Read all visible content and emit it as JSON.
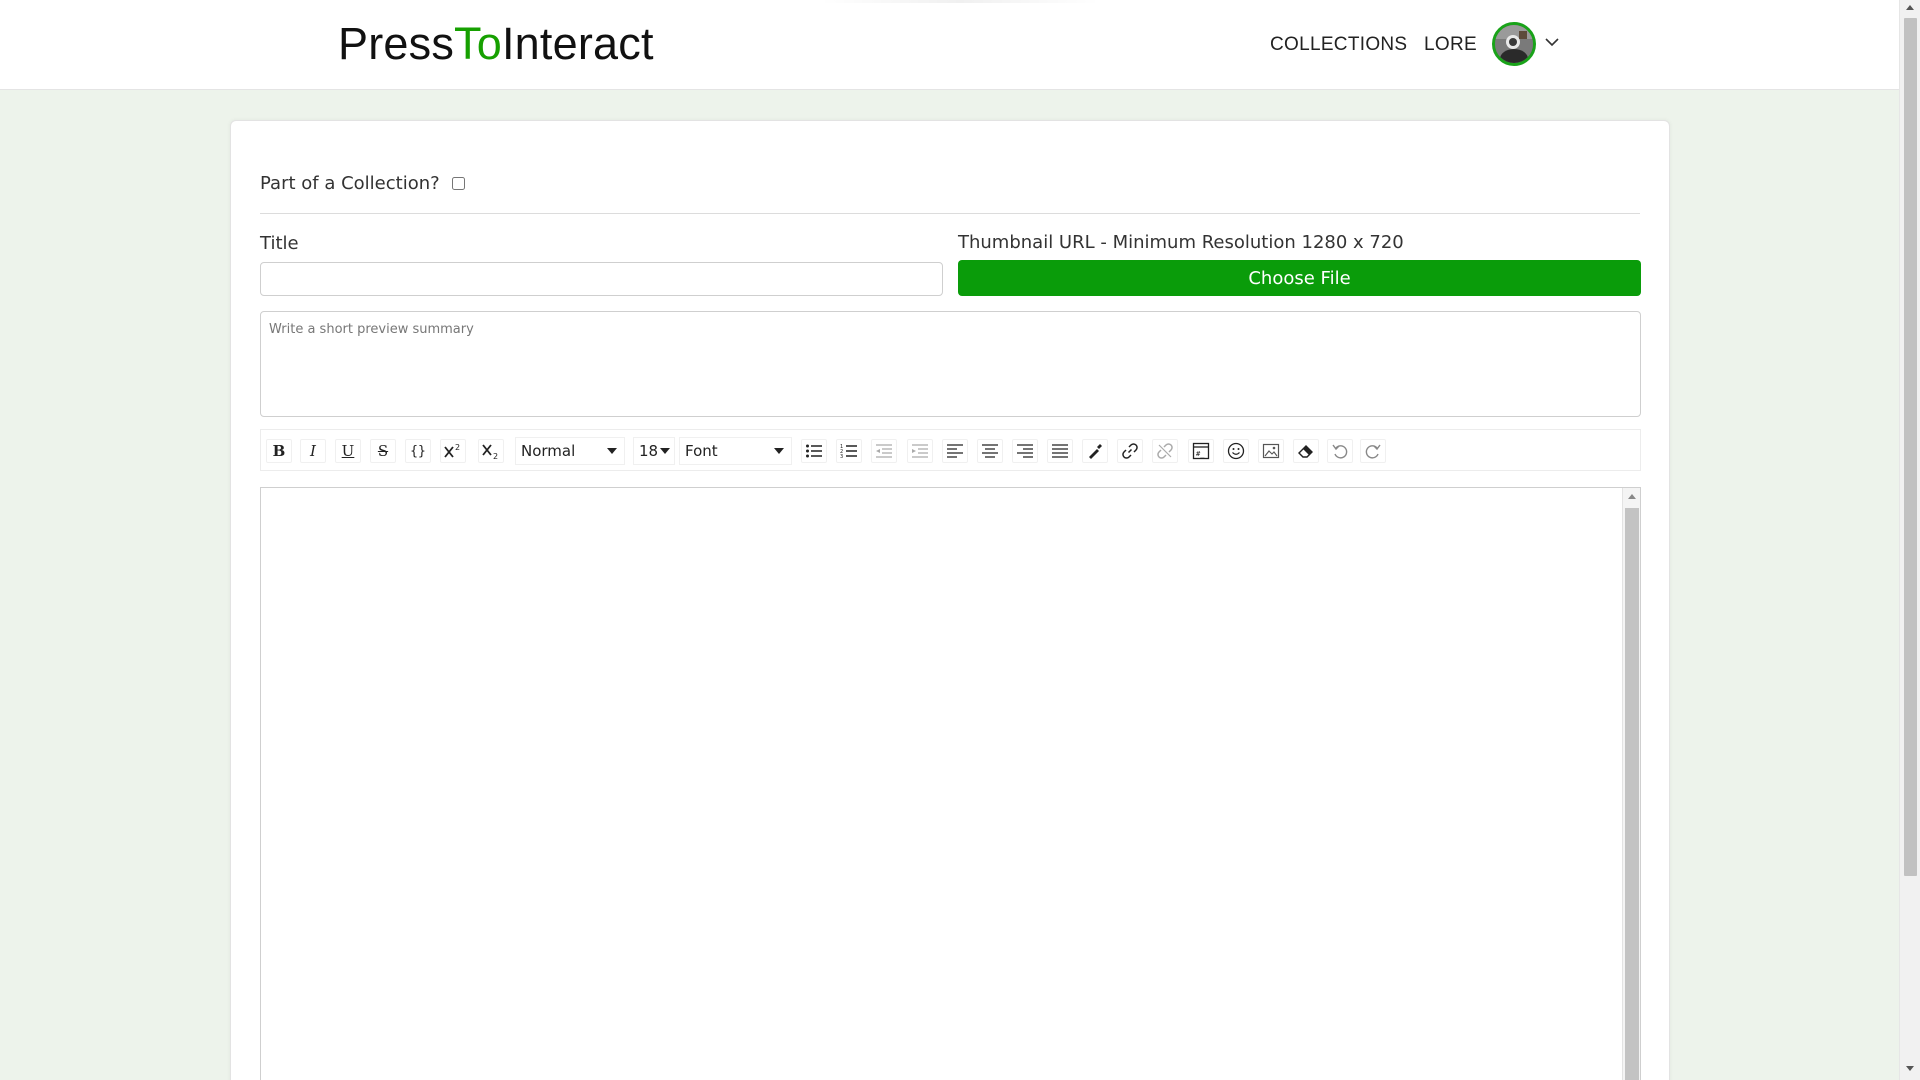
{
  "header": {
    "logo_part1": "Press",
    "logo_part2": "To",
    "logo_part3": "Interact",
    "nav": {
      "collections": "COLLECTIONS",
      "lore": "LORE"
    }
  },
  "form": {
    "collection_label": "Part of a Collection?",
    "collection_checked": false,
    "title_label": "Title",
    "title_value": "",
    "thumbnail_label": "Thumbnail URL - Minimum Resolution 1280 x 720",
    "choose_file_label": "Choose File",
    "summary_placeholder": "Write a short preview summary",
    "summary_value": ""
  },
  "toolbar": {
    "bold": "B",
    "italic": "I",
    "underline": "U",
    "strike": "S",
    "code": "{}",
    "header_select": "Normal",
    "size_select": "18",
    "font_select": "Font"
  },
  "icons": [
    "bold-icon",
    "italic-icon",
    "underline-icon",
    "strikethrough-icon",
    "code-icon",
    "superscript-icon",
    "subscript-icon",
    "bullet-list-icon",
    "numbered-list-icon",
    "outdent-icon",
    "indent-icon",
    "align-left-icon",
    "align-center-icon",
    "align-right-icon",
    "align-justify-icon",
    "color-picker-icon",
    "link-icon",
    "unlink-icon",
    "embed-icon",
    "emoji-icon",
    "image-icon",
    "eraser-icon",
    "undo-icon",
    "redo-icon",
    "chevron-down-icon"
  ],
  "colors": {
    "brand_green": "#16a000",
    "button_green": "#0a9c0a",
    "page_background": "#edf3eb"
  }
}
